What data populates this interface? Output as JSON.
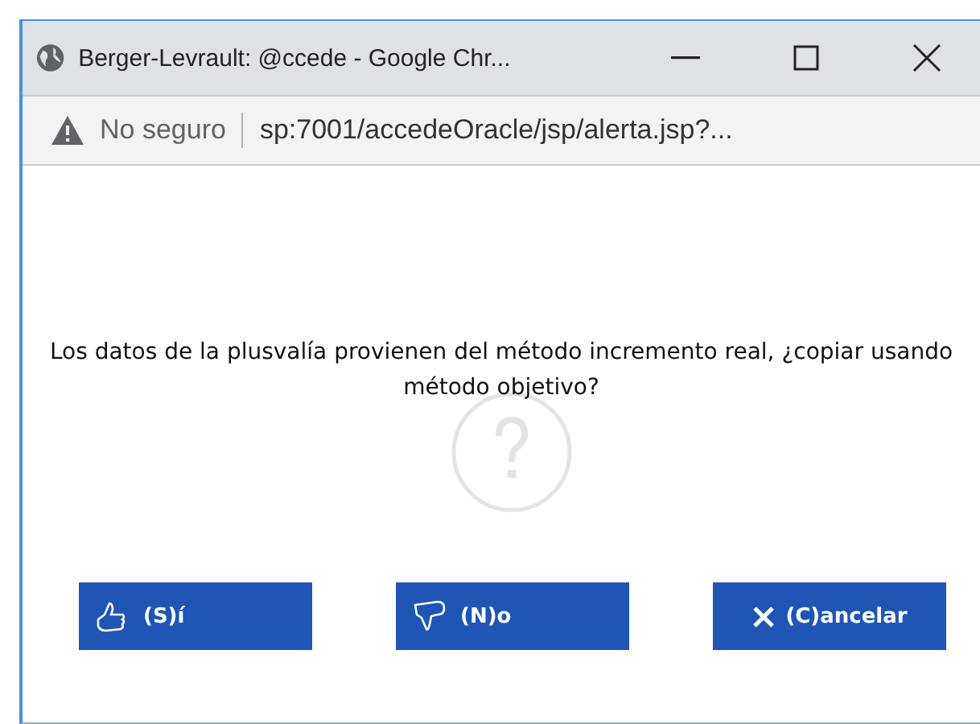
{
  "window": {
    "title": "Berger-Levrault: @ccede - Google Chr..."
  },
  "address_bar": {
    "security": "No seguro",
    "url": "sp:7001/accedeOracle/jsp/alerta.jsp?..."
  },
  "dialog": {
    "message": "Los datos de la plusvalía provienen del método incremento real, ¿copiar usando método objetivo?",
    "buttons": [
      {
        "kind": "yes",
        "label": "(S)í"
      },
      {
        "kind": "no",
        "label": "(N)o"
      },
      {
        "kind": "cancel",
        "label": "(C)ancelar"
      }
    ]
  }
}
